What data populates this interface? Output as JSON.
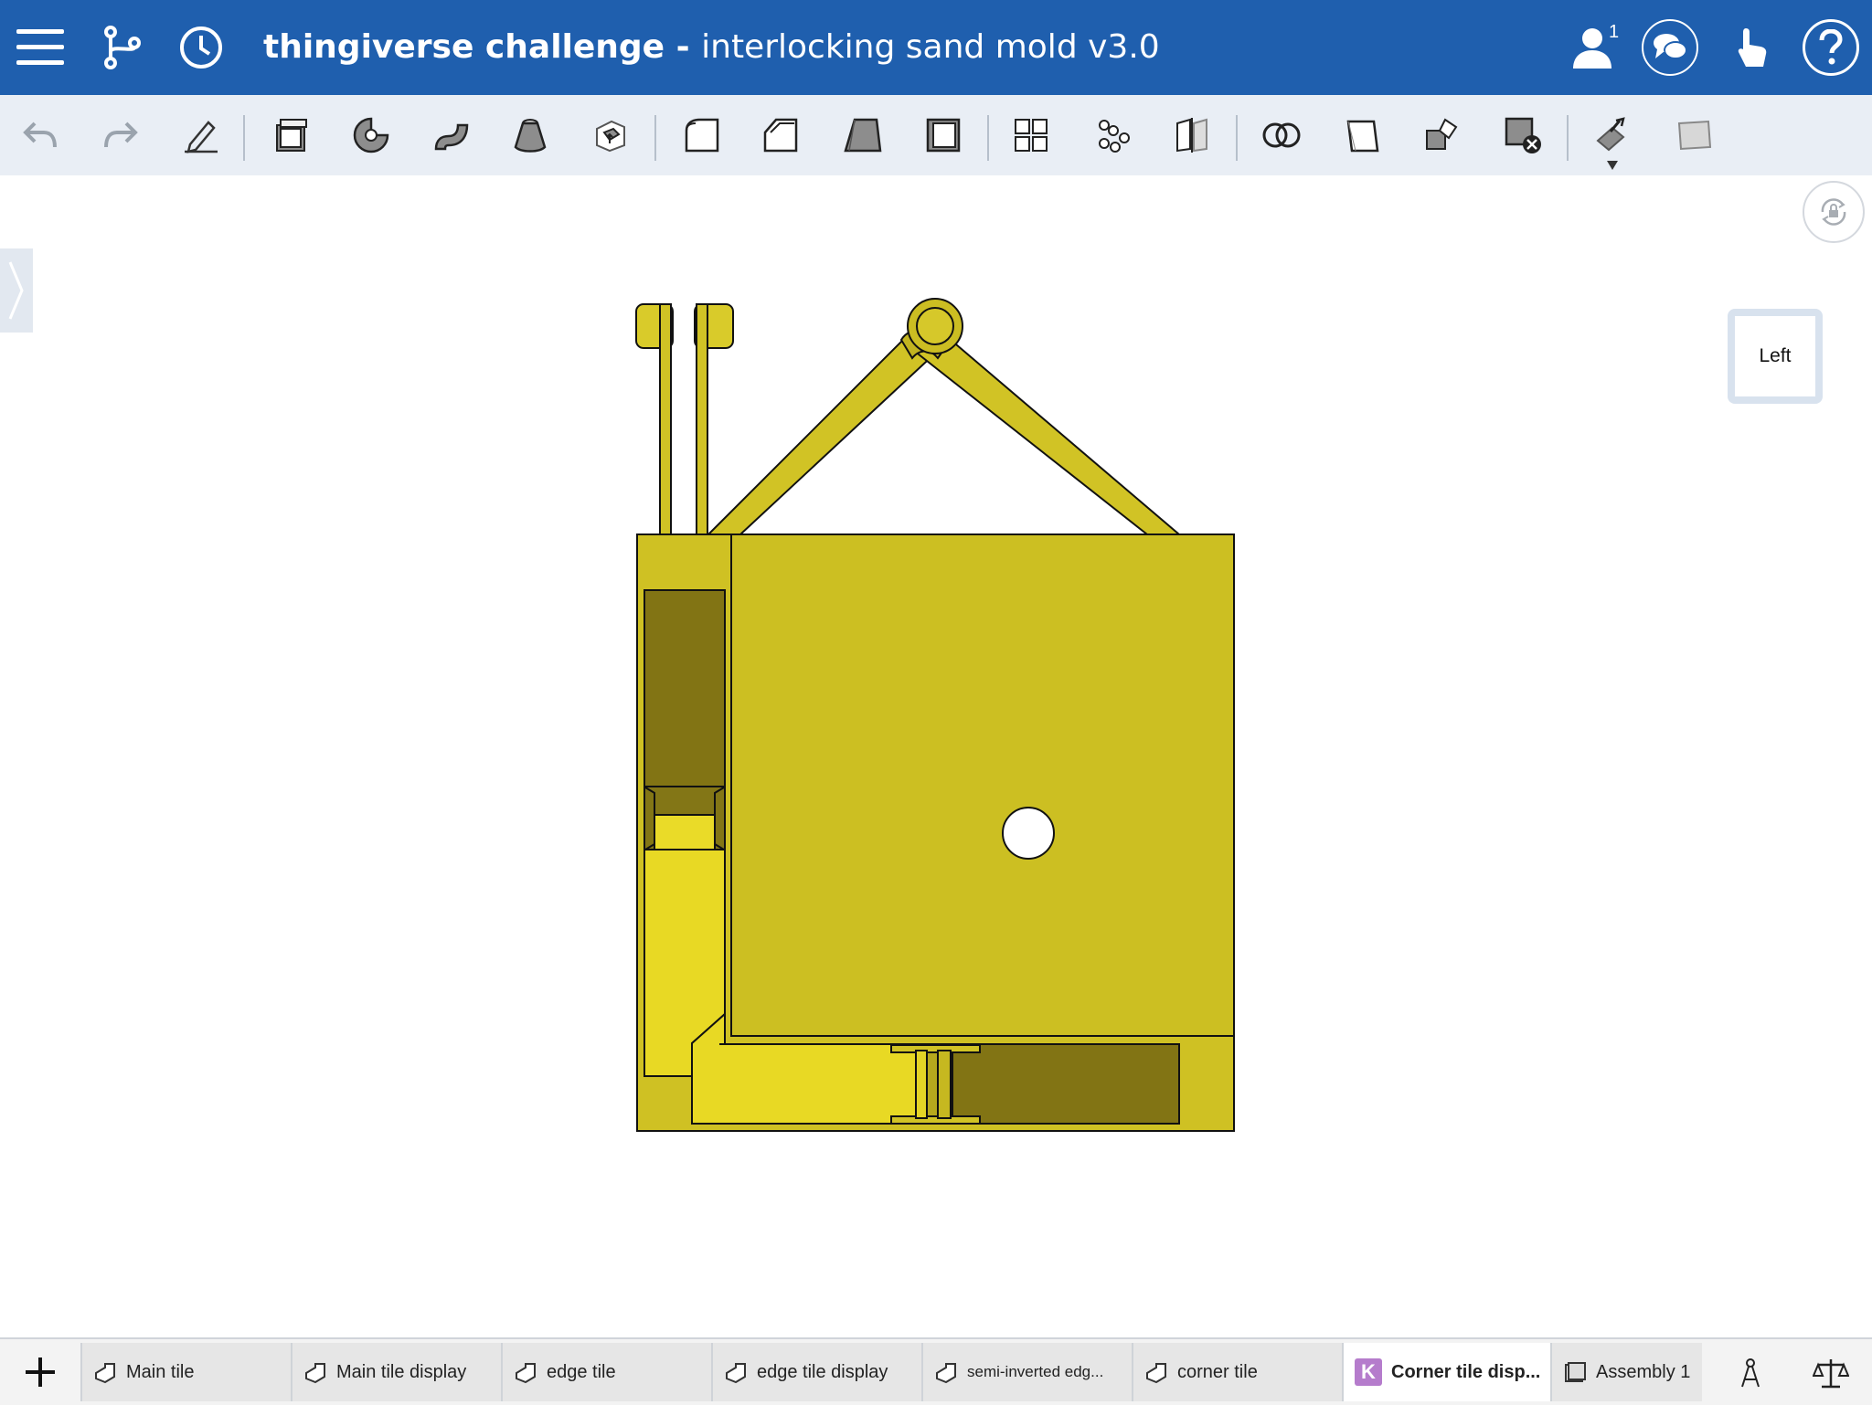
{
  "header": {
    "project": "thingiverse challenge",
    "separator": " - ",
    "document": "interlocking sand mold v3.0",
    "user_count": "1",
    "icons": [
      "menu-icon",
      "branch-icon",
      "history-icon",
      "user-icon",
      "chat-icon",
      "touch-icon",
      "help-icon"
    ]
  },
  "toolbar": {
    "tools": [
      "undo",
      "redo",
      "sketch",
      "extrude",
      "revolve",
      "sweep",
      "loft",
      "thicken",
      "fillet",
      "chamfer",
      "draft",
      "shell",
      "pattern",
      "mirror",
      "split",
      "boolean",
      "transform",
      "move-face",
      "delete-part",
      "mate",
      "plane"
    ]
  },
  "viewport": {
    "view_cube_label": "Left",
    "model_color": "#d1c325"
  },
  "tabs": [
    {
      "label": "Main tile",
      "type": "part-studio"
    },
    {
      "label": "Main tile display",
      "type": "part-studio"
    },
    {
      "label": "edge tile",
      "type": "part-studio"
    },
    {
      "label": "edge tile display",
      "type": "part-studio"
    },
    {
      "label": "semi-inverted edg...",
      "type": "part-studio"
    },
    {
      "label": "corner tile",
      "type": "part-studio"
    },
    {
      "label": "Corner tile disp...",
      "type": "part-studio",
      "active": true,
      "badge": "K"
    },
    {
      "label": "Assembly 1",
      "type": "assembly"
    }
  ],
  "colors": {
    "header_bg": "#1f5fae",
    "toolbar_bg": "#e9eef5",
    "model_yellow": "#d1c325",
    "model_dark": "#827414"
  }
}
